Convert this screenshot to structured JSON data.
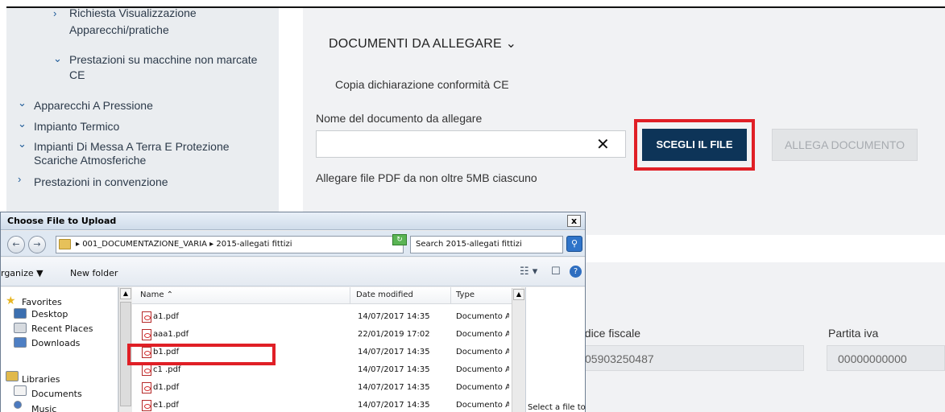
{
  "sidebar": {
    "items": [
      {
        "label_line1": "Richiesta Visualizzazione",
        "label_line2": "Apparecchi/pratiche",
        "chevron": "›"
      },
      {
        "label_line1": "Prestazioni su macchine non marcate",
        "label_line2": "CE",
        "chevron": "⌄"
      },
      {
        "label_line1": "Apparecchi A Pressione",
        "chevron": "⌄"
      },
      {
        "label_line1": "Impianto Termico",
        "chevron": "⌄"
      },
      {
        "label_line1": "Impianti Di Messa A Terra E Protezione",
        "label_line2": "Scariche Atmosferiche",
        "chevron": "⌄"
      },
      {
        "label_line1": "Prestazioni in convenzione",
        "chevron": "›"
      }
    ]
  },
  "main": {
    "section_title": "DOCUMENTI DA ALLEGARE ⌄",
    "document_name": "Copia dichiarazione conformità CE",
    "field_label": "Nome del documento da allegare",
    "field_value": "",
    "clear_symbol": "✕",
    "choose_file_label": "SCEGLI IL FILE",
    "attach_label": "ALLEGA DOCUMENTO",
    "hint": "Allegare file PDF da non oltre 5MB ciascuno",
    "codice_fiscale_label": "odice fiscale",
    "codice_fiscale_value": "05903250487",
    "partita_iva_label": "Partita iva",
    "partita_iva_value": "00000000000"
  },
  "dialog": {
    "title": "Choose File to Upload",
    "close_symbol": "x",
    "back_symbol": "←",
    "forward_symbol": "→",
    "breadcrumb": "▸ 001_DOCUMENTAZIONE_VARIA ▸ 2015-allegati fittizi",
    "addr_dropdown": "▼",
    "refresh_symbol": "↻",
    "search_placeholder": "Search 2015-allegati fittizi",
    "search_symbol": "⚲",
    "organize_label": "rganize ▼",
    "new_folder_label": "New folder",
    "view_symbol": "☷ ▾",
    "preview_symbol": "☐",
    "help_symbol": "?",
    "nav_items": {
      "favorites": "Favorites",
      "desktop": "Desktop",
      "recent_places": "Recent Places",
      "downloads": "Downloads",
      "libraries": "Libraries",
      "documents": "Documents",
      "music": "Music"
    },
    "columns": {
      "name": "Name ⌃",
      "date": "Date modified",
      "type": "Type"
    },
    "files": [
      {
        "name": "a1.pdf",
        "date": "14/07/2017 14:35",
        "type": "Documento Ac"
      },
      {
        "name": "aaa1.pdf",
        "date": "22/01/2019 17:02",
        "type": "Documento Ac"
      },
      {
        "name": "b1.pdf",
        "date": "14/07/2017 14:35",
        "type": "Documento Ac"
      },
      {
        "name": "c1 .pdf",
        "date": "14/07/2017 14:35",
        "type": "Documento Ac"
      },
      {
        "name": "d1.pdf",
        "date": "14/07/2017 14:35",
        "type": "Documento Ac"
      },
      {
        "name": "e1.pdf",
        "date": "14/07/2017 14:35",
        "type": "Documento Ac"
      }
    ],
    "preview_text": "Select a file to",
    "scroll_up_symbol": "▲"
  },
  "colors": {
    "primary_button": "#0d3458",
    "highlight": "#e01f26",
    "sidebar_bg": "#eaedf0",
    "panel_bg": "#f1f2f4"
  }
}
